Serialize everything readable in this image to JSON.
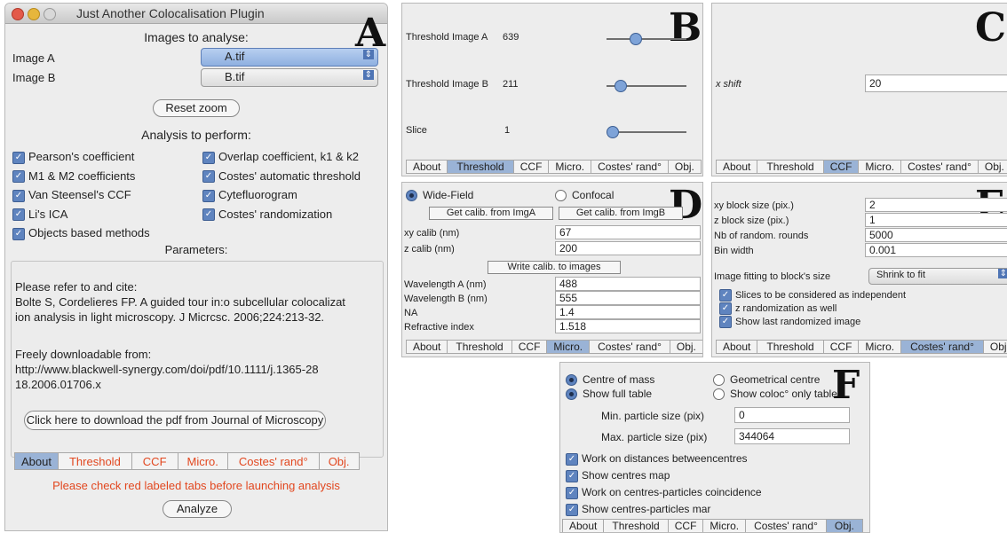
{
  "panel_a": {
    "label": "A",
    "window_title": "Just Another Colocalisation Plugin",
    "images_heading": "Images to analyse:",
    "image_a_label": "Image A",
    "image_a_value": "A.tif",
    "image_b_label": "Image B",
    "image_b_value": "B.tif",
    "reset_zoom": "Reset zoom",
    "analysis_heading": "Analysis to perform:",
    "options_left": [
      "Pearson's coefficient",
      "M1 & M2 coefficients",
      "Van Steensel's CCF",
      "Li's ICA",
      "Objects based methods"
    ],
    "options_right": [
      "Overlap coefficient, k1 & k2",
      "Costes' automatic threshold",
      "Cytefluorogram",
      "Costes' randomization"
    ],
    "parameters_heading": "Parameters:",
    "cite_line1": "Please refer to and cite:",
    "cite_line2": "Bolte S, Cordelieres FP. A guided tour in:o subcellular colocalizat",
    "cite_line3": "ion  analysis in light microscopy. J Micrcsc. 2006;224:213-32.",
    "download_line1": "Freely downloadable from:",
    "download_line2": "http://www.blackwell-synergy.com/doi/pdf/10.1111/j.1365-28",
    "download_line3": "18.2006.01706.x",
    "download_button": "Click here to download the pdf from Journal of Microscopy",
    "tabs": [
      "About",
      "Threshold",
      "CCF",
      "Micro.",
      "Costes' rand°",
      "Obj."
    ],
    "warning": "Please check red labeled tabs before launching analysis",
    "analyze_button": "Analyze"
  },
  "panel_b": {
    "label": "B",
    "rows": [
      {
        "label": "Threshold Image A",
        "value": "639",
        "level": 0.33
      },
      {
        "label": "Threshold Image B",
        "value": "211",
        "level": 0.11
      },
      {
        "label": "Slice",
        "value": "1",
        "level": 0.0
      }
    ],
    "tabs": [
      "About",
      "Threshold",
      "CCF",
      "Micro.",
      "Costes' rand°",
      "Obj."
    ]
  },
  "panel_c": {
    "label": "C",
    "shift_label": "x shift",
    "shift_value": "20",
    "tabs": [
      "About",
      "Threshold",
      "CCF",
      "Micro.",
      "Costes' rand°",
      "Obj."
    ]
  },
  "panel_d": {
    "label": "D",
    "wide_field": "Wide-Field",
    "confocal": "Confocal",
    "get_calib_a": "Get calib. from ImgA",
    "get_calib_b": "Get calib. from ImgB",
    "xy_calib_label": "xy calib (nm)",
    "xy_calib_value": "67",
    "z_calib_label": "z calib (nm)",
    "z_calib_value": "200",
    "write_calib": "Write calib. to images",
    "wavelength_a_label": "Wavelength A (nm)",
    "wavelength_a_value": "488",
    "wavelength_b_label": "Wavelength B (nm)",
    "wavelength_b_value": "555",
    "na_label": "NA",
    "na_value": "1.4",
    "ri_label": "Refractive index",
    "ri_value": "1.518",
    "tabs": [
      "About",
      "Threshold",
      "CCF",
      "Micro.",
      "Costes' rand°",
      "Obj."
    ]
  },
  "panel_e": {
    "label": "E",
    "xy_block_label": "xy block size (pix.)",
    "xy_block_value": "2",
    "z_block_label": "z block size (pix.)",
    "z_block_value": "1",
    "rounds_label": "Nb of random. rounds",
    "rounds_value": "5000",
    "bin_label": "Bin width",
    "bin_value": "0.001",
    "fitting_label": "Image fitting to block's size",
    "fitting_value": "Shrink to fit",
    "check1": "Slices to be considered as independent",
    "check2": "z randomization as well",
    "check3": "Show last randomized image",
    "tabs": [
      "About",
      "Threshold",
      "CCF",
      "Micro.",
      "Costes' rand°",
      "Obj."
    ]
  },
  "panel_f": {
    "label": "F",
    "centre_of_mass": "Centre of mass",
    "geometrical_centre": "Geometrical centre",
    "show_full_table": "Show full table",
    "show_coloc_table": "Show coloc° only table",
    "min_label": "Min. particle size (pix)",
    "min_value": "0",
    "max_label": "Max. particle size (pix)",
    "max_value": "344064",
    "check1": "Work on distances betweencentres",
    "check2": "Show centres map",
    "check3": "Work on centres-particles coincidence",
    "check4": "Show centres-particles mar",
    "tabs": [
      "About",
      "Threshold",
      "CCF",
      "Micro.",
      "Costes' rand°",
      "Obj."
    ]
  },
  "colors": {
    "selected_tab": "#9ab3d6",
    "red_tab": "#e2471f",
    "checkbox": "#5f84bf"
  }
}
